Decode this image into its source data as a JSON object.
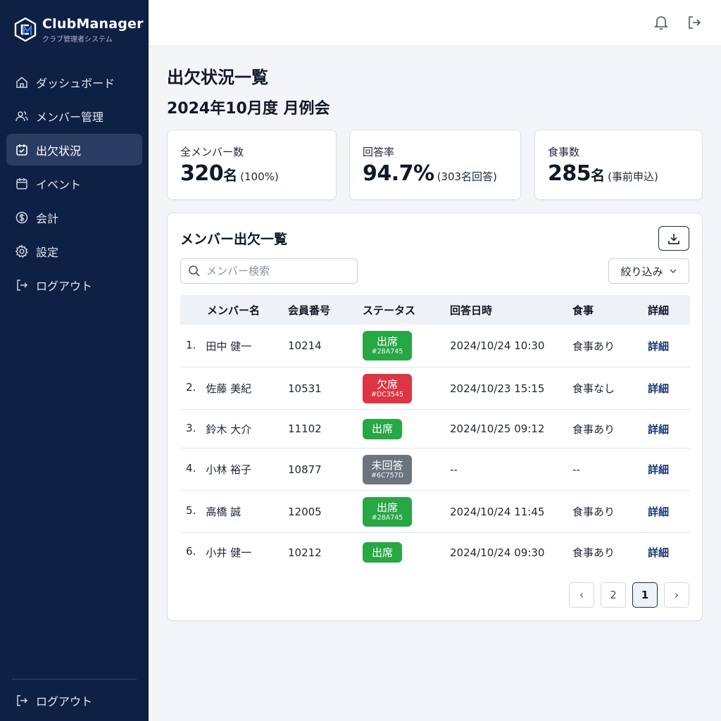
{
  "brand": {
    "name": "ClubManager",
    "subtitle": "クラブ管理者システム"
  },
  "sidebar": {
    "items": [
      {
        "label": "ダッシュボード",
        "icon": "home-icon",
        "active": false
      },
      {
        "label": "メンバー管理",
        "icon": "users-icon",
        "active": false
      },
      {
        "label": "出欠状況",
        "icon": "calendar-check-icon",
        "active": true
      },
      {
        "label": "イベント",
        "icon": "calendar-icon",
        "active": false
      },
      {
        "label": "会計",
        "icon": "dollar-icon",
        "active": false
      },
      {
        "label": "設定",
        "icon": "gear-icon",
        "active": false
      },
      {
        "label": "ログアウト",
        "icon": "logout-icon",
        "active": false
      }
    ],
    "bottom_logout": "ログアウト"
  },
  "header": {
    "icons": [
      "bell-icon",
      "logout-icon"
    ]
  },
  "page": {
    "title": "出欠状況一覧",
    "subtitle": "2024年10月度 月例会"
  },
  "stats": [
    {
      "label": "全メンバー数",
      "value": "320",
      "unit": "名",
      "note": "(100%)"
    },
    {
      "label": "回答率",
      "value": "94.7%",
      "unit": "",
      "note": "(303名回答)"
    },
    {
      "label": "食事数",
      "value": "285",
      "unit": "名",
      "note": "(事前申込)"
    }
  ],
  "table": {
    "title": "メンバー出欠一覧",
    "search_placeholder": "メンバー検索",
    "filter_label": "絞り込み",
    "headers": {
      "name": "メンバー名",
      "id": "会員番号",
      "status": "ステータス",
      "date": "回答日時",
      "meal": "食事",
      "detail": "詳細"
    },
    "rows": [
      {
        "no": "1.",
        "name": "田中 健一",
        "id": "10214",
        "status": "出席",
        "status_hex": "#28A745",
        "date": "2024/10/24 10:30",
        "meal": "食事あり",
        "detail": "詳細"
      },
      {
        "no": "2.",
        "name": "佐藤 美紀",
        "id": "10531",
        "status": "欠席",
        "status_hex": "#DC3545",
        "date": "2024/10/23 15:15",
        "meal": "食事なし",
        "detail": "詳細"
      },
      {
        "no": "3.",
        "name": "鈴木 大介",
        "id": "11102",
        "status": "出席",
        "status_hex": "",
        "date": "2024/10/25 09:12",
        "meal": "食事あり",
        "detail": "詳細"
      },
      {
        "no": "4.",
        "name": "小林 裕子",
        "id": "10877",
        "status": "未回答",
        "status_hex": "#6C757D",
        "date": "--",
        "meal": "--",
        "detail": "詳細"
      },
      {
        "no": "5.",
        "name": "高橋 誠",
        "id": "12005",
        "status": "出席",
        "status_hex": "#28A745",
        "date": "2024/10/24 11:45",
        "meal": "食事あり",
        "detail": "詳細"
      },
      {
        "no": "6.",
        "name": "小井 健一",
        "id": "10212",
        "status": "出席",
        "status_hex": "",
        "date": "2024/10/24 09:30",
        "meal": "食事あり",
        "detail": "詳細"
      }
    ]
  },
  "pagination": {
    "prev": "‹",
    "pages": [
      "2",
      "1"
    ],
    "current": "1",
    "next": "›"
  },
  "colors": {
    "sidebar": "#0F2045",
    "present": "#28A745",
    "absent": "#DC3545",
    "unanswered": "#6C757D",
    "link": "#1D3A72"
  }
}
